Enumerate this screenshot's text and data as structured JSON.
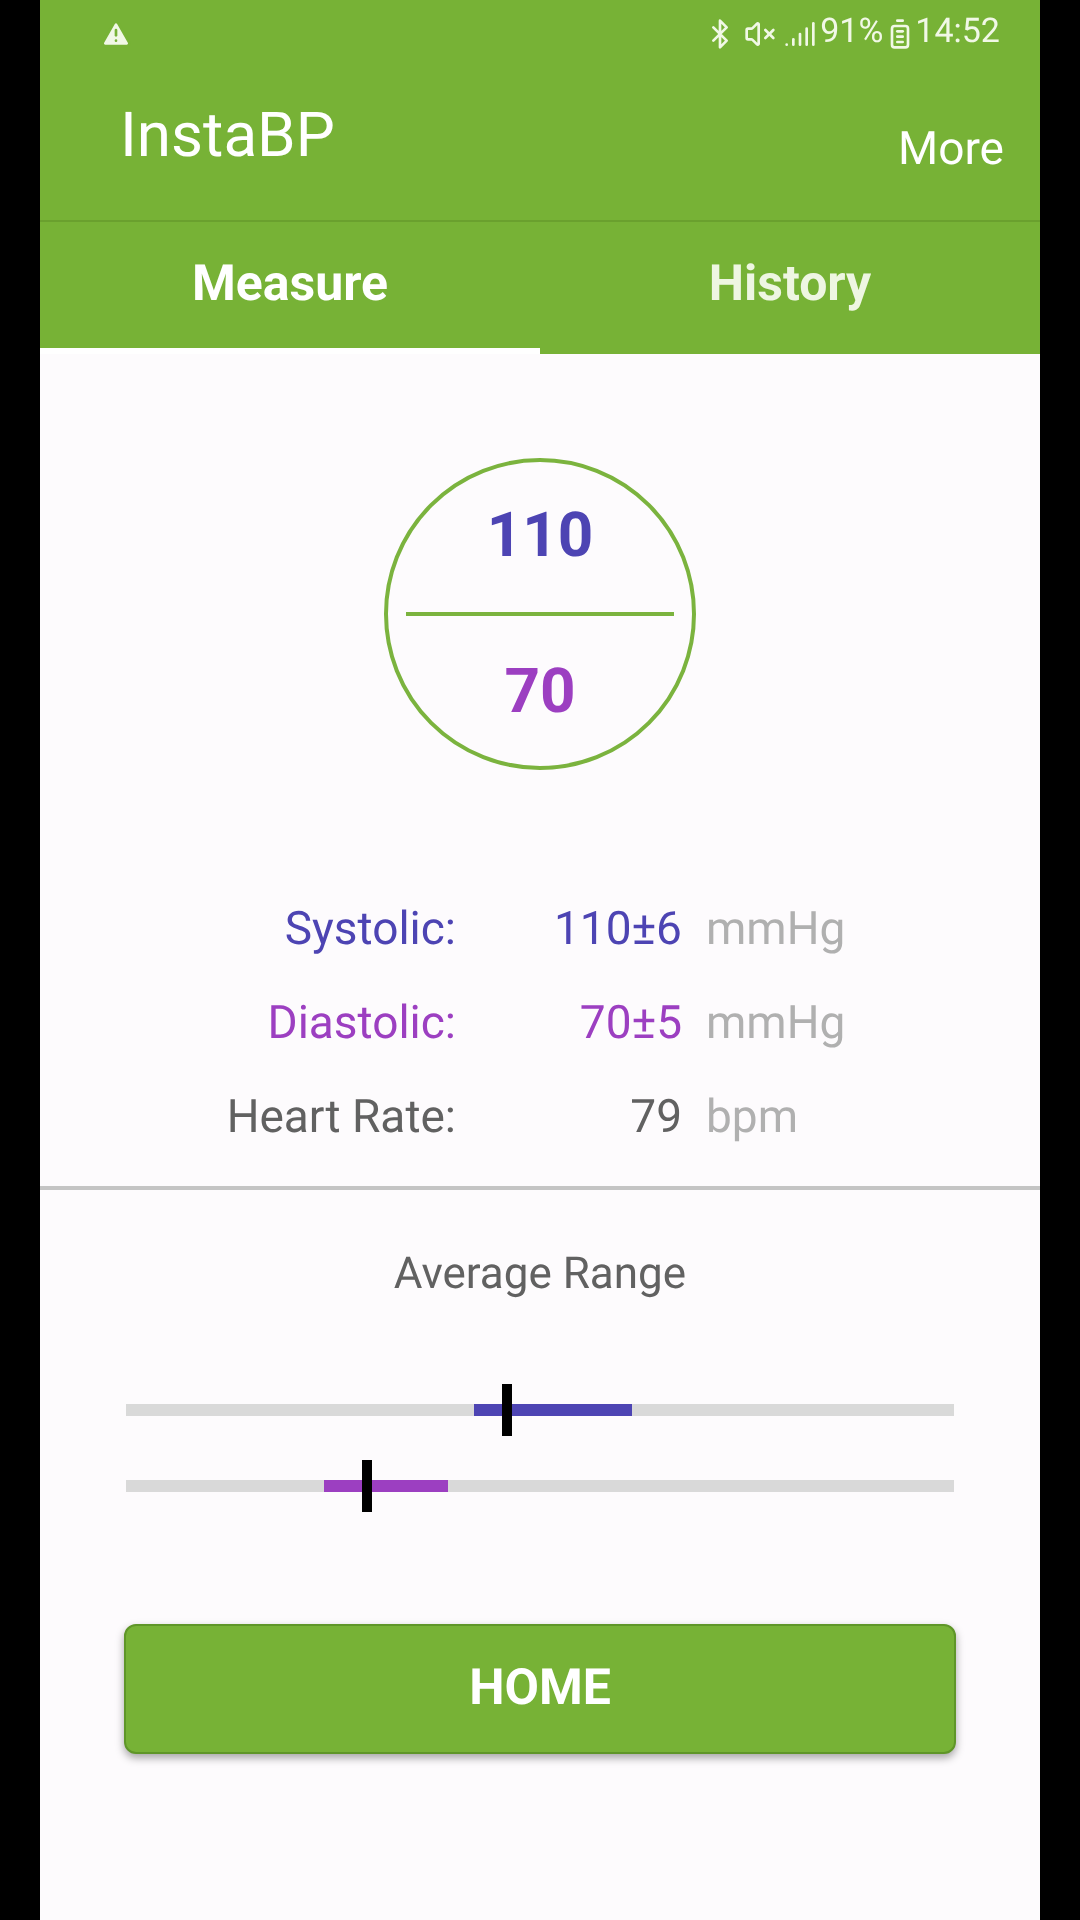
{
  "status_bar": {
    "battery": "91%",
    "time": "14:52"
  },
  "app_bar": {
    "title": "InstaBP",
    "action": "More"
  },
  "tabs": [
    {
      "label": "Measure",
      "selected": true
    },
    {
      "label": "History",
      "selected": false
    }
  ],
  "gauge": {
    "top": {
      "value": "110",
      "color": "#4d44b3"
    },
    "bottom": {
      "value": "70",
      "color": "#9c3fc1"
    }
  },
  "readings": [
    {
      "label": "Systolic:",
      "value": "110±6",
      "unit": "mmHg",
      "color": "#4d44b3"
    },
    {
      "label": "Diastolic:",
      "value": "70±5",
      "unit": "mmHg",
      "color": "#9c3fc1"
    },
    {
      "label": "Heart Rate:",
      "value": "79",
      "unit": "bpm",
      "color": "#616161"
    }
  ],
  "average_range": {
    "title": "Average Range",
    "ranges": [
      {
        "color": "#4d44b3",
        "low": {
          "level": 0.42
        },
        "high": {
          "level": 0.61
        },
        "marker": {
          "level": 0.46
        }
      },
      {
        "color": "#9c3fc1",
        "low": {
          "level": 0.24
        },
        "high": {
          "level": 0.39
        },
        "marker": {
          "level": 0.29
        }
      }
    ]
  },
  "button": "HOME"
}
